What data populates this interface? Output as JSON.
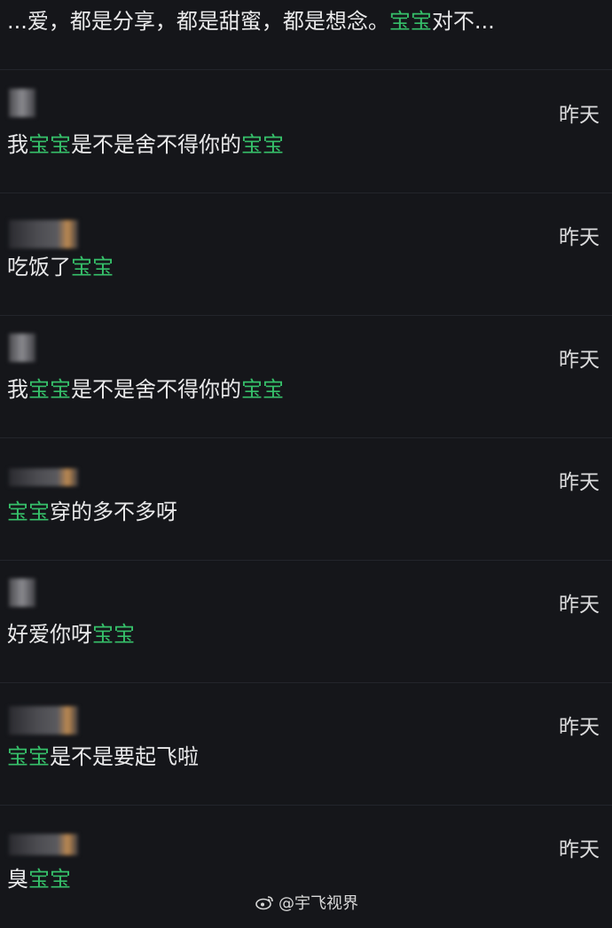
{
  "header": {
    "preview_a": "...爱，都是分享，都是甜蜜，都是想念。",
    "preview_b": "宝宝",
    "preview_c": "对不..."
  },
  "comments": [
    {
      "time": "昨天",
      "p1": "我",
      "h1": "宝宝",
      "p2": "是不是舍不得你的",
      "h2": "宝宝"
    },
    {
      "time": "昨天",
      "p1": "吃饭了",
      "h1": "宝宝",
      "p2": "",
      "h2": ""
    },
    {
      "time": "昨天",
      "p1": "我",
      "h1": "宝宝",
      "p2": "是不是舍不得你的",
      "h2": "宝宝"
    },
    {
      "time": "昨天",
      "p1": "",
      "h1": "宝宝",
      "p2": "穿的多不多呀",
      "h2": ""
    },
    {
      "time": "昨天",
      "p1": "好爱你呀",
      "h1": "宝宝",
      "p2": "",
      "h2": ""
    },
    {
      "time": "昨天",
      "p1": "",
      "h1": "宝宝",
      "p2": "是不是要起飞啦",
      "h2": ""
    },
    {
      "time": "昨天",
      "p1": "臭",
      "h1": "宝宝",
      "p2": "",
      "h2": ""
    }
  ],
  "watermark": {
    "text": "@宇飞视界",
    "icon": "weibo-icon"
  },
  "colors": {
    "background": "#15161a",
    "highlight": "#36c06a",
    "text": "#e9e9ea"
  }
}
